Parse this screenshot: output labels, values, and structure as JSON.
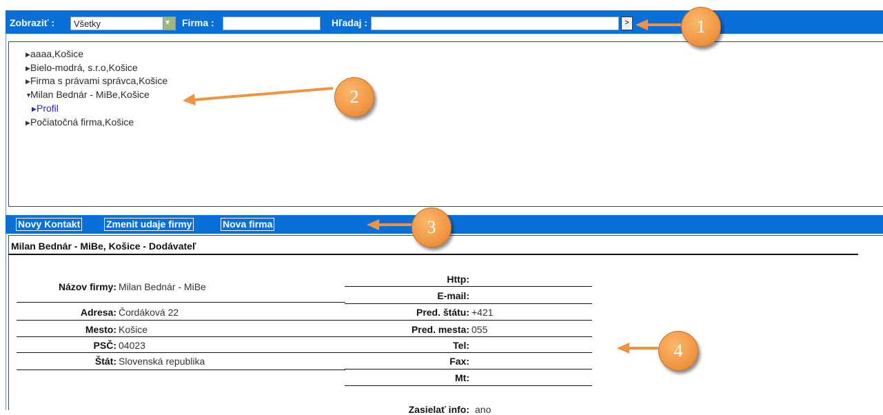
{
  "filter_bar": {
    "show_label": "Zobraziť :",
    "show_value": "Všetky",
    "firm_label": "Firma :",
    "firm_value": "",
    "search_label": "Hľadaj :",
    "search_value": "",
    "go_label": ">"
  },
  "tree": {
    "items": [
      {
        "label": "aaaa,Košice",
        "expanded": false
      },
      {
        "label": "Bielo-modrá, s.r.o,Košice",
        "expanded": false
      },
      {
        "label": "Firma s právami správca,Košice",
        "expanded": false
      },
      {
        "label": "Milan Bednár - MiBe,Košice",
        "expanded": true
      },
      {
        "label": "Profil",
        "child": true
      },
      {
        "label": "Počiatočná firma,Košice",
        "expanded": false
      }
    ]
  },
  "actions": {
    "new_contact": "Novy Kontakt",
    "change_company": "Zmenit udaje firmy",
    "new_company": "Nova firma"
  },
  "details": {
    "title": "Milan Bednár - MiBe, Košice - Dodávateľ",
    "left": [
      {
        "label": "Názov firmy:",
        "value": "Milan Bednár - MiBe"
      },
      {
        "label": "Adresa:",
        "value": "Čordáková 22"
      },
      {
        "label": "Mesto:",
        "value": "Košice"
      },
      {
        "label": "PSČ:",
        "value": "04023"
      },
      {
        "label": "Štát:",
        "value": "Slovenská republika"
      }
    ],
    "right": [
      {
        "label": "Http:",
        "value": ""
      },
      {
        "label": "E-mail:",
        "value": ""
      },
      {
        "label": "Pred. štátu:",
        "value": "+421"
      },
      {
        "label": "Pred. mesta:",
        "value": "055"
      },
      {
        "label": "Tel:",
        "value": ""
      },
      {
        "label": "Fax:",
        "value": ""
      },
      {
        "label": "Mt:",
        "value": ""
      }
    ],
    "info_label": "Zasielať info:",
    "info_value": "ano"
  },
  "callouts": [
    "1",
    "2",
    "3",
    "4"
  ],
  "colors": {
    "bar": "#0b6fd8",
    "callout": "#f29a48",
    "link": "#2323c8"
  }
}
